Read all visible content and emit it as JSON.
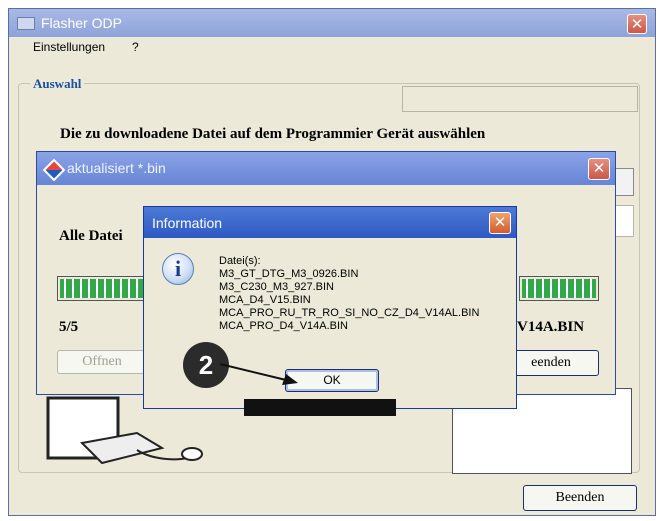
{
  "main_window": {
    "title": "Flasher ODP",
    "menu": [
      "Einstellungen",
      "?"
    ],
    "group_label": "Auswahl",
    "instruction": "Die zu downloadene Datei auf dem Programmier Gerät auswählen",
    "beenden_label": "Beenden"
  },
  "child_window": {
    "title": "aktualisiert *.bin",
    "body_text": "Alle Datei",
    "progress": 1.0,
    "count": "5/5",
    "file_fragment": "V14A.BIN",
    "offnen_label": "Offnen",
    "beenden_label": "eenden"
  },
  "info_dialog": {
    "title": "Information",
    "icon": "info-icon",
    "lines": [
      "Datei(s):",
      "M3_GT_DTG_M3_0926.BIN",
      "M3_C230_M3_927.BIN",
      "MCA_D4_V15.BIN",
      "MCA_PRO_RU_TR_RO_SI_NO_CZ_D4_V14AL.BIN",
      "MCA_PRO_D4_V14A.BIN"
    ],
    "ok_label": "OK"
  },
  "callout": "2"
}
